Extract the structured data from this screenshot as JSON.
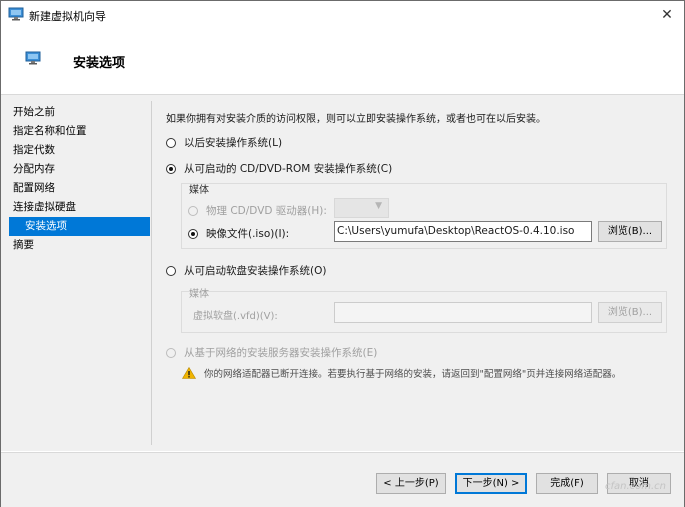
{
  "window": {
    "title": "新建虚拟机向导",
    "close_glyph": "✕"
  },
  "header": {
    "title": "安装选项"
  },
  "nav": {
    "items": [
      {
        "label": "开始之前"
      },
      {
        "label": "指定名称和位置"
      },
      {
        "label": "指定代数"
      },
      {
        "label": "分配内存"
      },
      {
        "label": "配置网络"
      },
      {
        "label": "连接虚拟硬盘"
      },
      {
        "label": "安装选项"
      },
      {
        "label": "摘要"
      }
    ],
    "active_item": "安装选项"
  },
  "content": {
    "intro": "如果你拥有对安装介质的访问权限，则可以立即安装操作系统，或者也可在以后安装。",
    "options": {
      "later": {
        "label": "以后安装操作系统(L)"
      },
      "cd": {
        "label": "从可启动的 CD/DVD-ROM 安装操作系统(C)",
        "selected": true
      },
      "floppy": {
        "label": "从可启动软盘安装操作系统(O)"
      },
      "network": {
        "label": "从基于网络的安装服务器安装操作系统(E)"
      }
    },
    "cd_media": {
      "group_label": "媒体",
      "physical_label": "物理 CD/DVD 驱动器(H):",
      "physical_value": "",
      "image_label": "映像文件(.iso)(I):",
      "image_value": "C:\\Users\\yumufa\\Desktop\\ReactOS-0.4.10.iso",
      "browse_label": "浏览(B)..."
    },
    "floppy_media": {
      "group_label": "媒体",
      "vfd_label": "虚拟软盘(.vfd)(V):",
      "vfd_value": "",
      "browse_label": "浏览(B)..."
    },
    "warning": "你的网络适配器已断开连接。若要执行基于网络的安装，请返回到\"配置网络\"页并连接网络适配器。"
  },
  "footer": {
    "prev": "< 上一步(P)",
    "next": "下一步(N) >",
    "finish": "完成(F)",
    "cancel": "取消"
  },
  "watermark": "cfan.com.cn",
  "colors": {
    "accent": "#0078d7",
    "warning": "#f0b400",
    "panel": "#f0f0f0"
  },
  "icons": {
    "app": "monitor-icon",
    "header": "monitor-icon",
    "warning": "warning-triangle-icon",
    "close": "close-icon"
  }
}
